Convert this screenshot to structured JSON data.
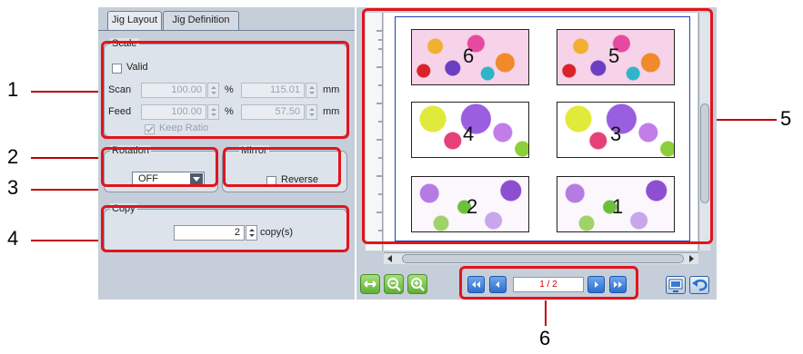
{
  "tabs": [
    {
      "label": "Jig Layout",
      "active": true
    },
    {
      "label": "Jig Definition",
      "active": false
    }
  ],
  "scale": {
    "title": "Scale",
    "valid_label": "Valid",
    "scan_label": "Scan",
    "scan_percent": "100.00",
    "scan_mm": "115.01",
    "feed_label": "Feed",
    "feed_percent": "100.00",
    "feed_mm": "57.50",
    "percent_unit": "%",
    "mm_unit": "mm",
    "keep_ratio_label": "Keep Ratio"
  },
  "rotation": {
    "title": "Rotation",
    "value": "OFF"
  },
  "mirror": {
    "title": "Mirror",
    "reverse_label": "Reverse"
  },
  "copy": {
    "title": "Copy",
    "value": "2",
    "unit": "copy(s)"
  },
  "preview": {
    "tiles": [
      "6",
      "5",
      "4",
      "3",
      "2",
      "1"
    ]
  },
  "pager": {
    "page": "1 / 2"
  },
  "callouts": [
    "1",
    "2",
    "3",
    "4",
    "5",
    "6"
  ],
  "colors": {
    "highlight": "#e0141e",
    "panel": "#c6cfd9",
    "nav_blue": "#2c6fd0"
  }
}
